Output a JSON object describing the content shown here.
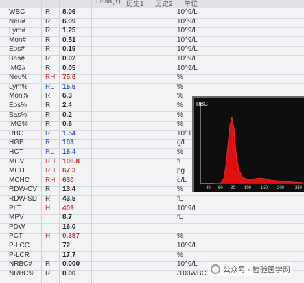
{
  "header": {
    "col_delta": "Delta(+)",
    "col_history1": "历史1",
    "col_history2": "历史2",
    "col_unit": "单位"
  },
  "results": [
    {
      "name": "WBC",
      "flag": "R",
      "value": "8.06",
      "unit": "10^9/L",
      "flag_color": "normal"
    },
    {
      "name": "Neu#",
      "flag": "R",
      "value": "6.09",
      "unit": "10^9/L",
      "flag_color": "normal"
    },
    {
      "name": "Lym#",
      "flag": "R",
      "value": "1.25",
      "unit": "10^9/L",
      "flag_color": "normal"
    },
    {
      "name": "Mon#",
      "flag": "R",
      "value": "0.51",
      "unit": "10^9/L",
      "flag_color": "normal"
    },
    {
      "name": "Eos#",
      "flag": "R",
      "value": "0.19",
      "unit": "10^9/L",
      "flag_color": "normal"
    },
    {
      "name": "Bas#",
      "flag": "R",
      "value": "0.02",
      "unit": "10^9/L",
      "flag_color": "normal"
    },
    {
      "name": "IMG#",
      "flag": "R",
      "value": "0.05",
      "unit": "10^9/L",
      "flag_color": "normal"
    },
    {
      "name": "Neu%",
      "flag": "RH",
      "value": "75.6",
      "unit": "%",
      "flag_color": "high"
    },
    {
      "name": "Lym%",
      "flag": "RL",
      "value": "15.5",
      "unit": "%",
      "flag_color": "low"
    },
    {
      "name": "Mon%",
      "flag": "R",
      "value": "6.3",
      "unit": "%",
      "flag_color": "normal"
    },
    {
      "name": "Eos%",
      "flag": "R",
      "value": "2.4",
      "unit": "%",
      "flag_color": "normal"
    },
    {
      "name": "Bas%",
      "flag": "R",
      "value": "0.2",
      "unit": "%",
      "flag_color": "normal"
    },
    {
      "name": "IMG%",
      "flag": "R",
      "value": "0.6",
      "unit": "%",
      "flag_color": "normal"
    },
    {
      "name": "RBC",
      "flag": "RL",
      "value": "1.54",
      "unit": "10^1",
      "flag_color": "low"
    },
    {
      "name": "HGB",
      "flag": "RL",
      "value": "103",
      "unit": "g/L",
      "flag_color": "low"
    },
    {
      "name": "HCT",
      "flag": "RL",
      "value": "16.4",
      "unit": "%",
      "flag_color": "low"
    },
    {
      "name": "MCV",
      "flag": "RH",
      "value": "106.8",
      "unit": "fL",
      "flag_color": "high"
    },
    {
      "name": "MCH",
      "flag": "RH",
      "value": "67.3",
      "unit": "pg",
      "flag_color": "high"
    },
    {
      "name": "MCHC",
      "flag": "RH",
      "value": "630",
      "unit": "g/L",
      "flag_color": "high"
    },
    {
      "name": "RDW-CV",
      "flag": "R",
      "value": "13.4",
      "unit": "%",
      "flag_color": "normal"
    },
    {
      "name": "RDW-SD",
      "flag": "R",
      "value": "43.5",
      "unit": "fL",
      "flag_color": "normal"
    },
    {
      "name": "PLT",
      "flag": "H",
      "value": "409",
      "unit": "10^9/L",
      "flag_color": "high"
    },
    {
      "name": "MPV",
      "flag": "",
      "value": "8.7",
      "unit": "fL",
      "flag_color": "normal"
    },
    {
      "name": "PDW",
      "flag": "",
      "value": "16.0",
      "unit": "",
      "flag_color": "normal"
    },
    {
      "name": "PCT",
      "flag": "H",
      "value": "0.357",
      "unit": "%",
      "flag_color": "high"
    },
    {
      "name": "P-LCC",
      "flag": "",
      "value": "72",
      "unit": "10^9/L",
      "flag_color": "normal"
    },
    {
      "name": "P-LCR",
      "flag": "",
      "value": "17.7",
      "unit": "%",
      "flag_color": "normal"
    },
    {
      "name": "NRBC#",
      "flag": "R",
      "value": "0.000",
      "unit": "10^9/L",
      "flag_color": "normal"
    },
    {
      "name": "NRBC%",
      "flag": "R",
      "value": "0.00",
      "unit": "/100WBC",
      "flag_color": "normal"
    }
  ],
  "histogram": {
    "title": "RBC",
    "x_ticks": [
      "40",
      "60",
      "80",
      "100",
      "150",
      "200",
      "250"
    ],
    "curve_color": "#e01010"
  },
  "watermark": {
    "text": "公众号 · 检验医学网"
  },
  "colors": {
    "high": "#d02c2c",
    "low": "#2350c8"
  }
}
